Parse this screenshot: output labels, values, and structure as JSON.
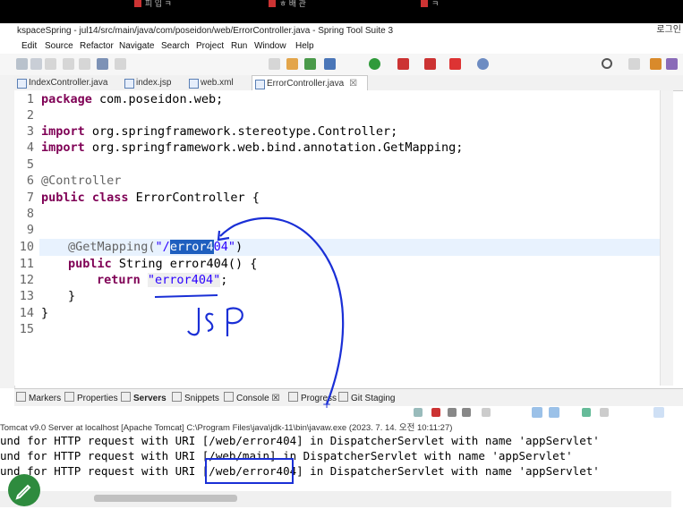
{
  "taskbar": {
    "tabs": [
      "피 입 ㅋ",
      "ㅎ 배 관",
      "ㅋ"
    ],
    "corner": "로그인"
  },
  "window": {
    "title": "kspaceSpring - jul14/src/main/java/com/poseidon/web/ErrorController.java - Spring Tool Suite 3"
  },
  "menu": [
    "Edit",
    "Source",
    "Refactor",
    "Navigate",
    "Search",
    "Project",
    "Run",
    "Window",
    "Help"
  ],
  "editor_tabs": [
    {
      "label": "IndexController.java"
    },
    {
      "label": "index.jsp"
    },
    {
      "label": "web.xml"
    },
    {
      "label": "ErrorController.java",
      "close": "☒"
    }
  ],
  "code": {
    "line_numbers": [
      "1",
      "2",
      "3",
      "4",
      "5",
      "6",
      "7",
      "8",
      "9",
      "10",
      "11",
      "12",
      "13",
      "14",
      "15"
    ],
    "l1_kw": "package",
    "l1_rest": " com.poseidon.web;",
    "l3_kw": "import",
    "l3_rest": " org.springframework.stereotype.Controller;",
    "l4_kw": "import",
    "l4_rest": " org.springframework.web.bind.annotation.GetMapping;",
    "l6": "@Controller",
    "l7_kw": "public class",
    "l7_rest": " ErrorController {",
    "l10_ann": "@GetMapping(",
    "l10_str_a": "\"/",
    "l10_sel": "error4",
    "l10_str_b": "04\"",
    "l10_end": ")",
    "l11_kw": "public",
    "l11_rest": " String error404() {",
    "l12_kw": "return",
    "l12_str": "\"error404\"",
    "l12_end": ";",
    "l13": "}",
    "l14": "}"
  },
  "panel_tabs": [
    {
      "label": "Markers"
    },
    {
      "label": "Properties"
    },
    {
      "label": "Servers"
    },
    {
      "label": "Snippets"
    },
    {
      "label": "Console ☒"
    },
    {
      "label": "Progress"
    },
    {
      "label": "Git Staging"
    }
  ],
  "console": {
    "description": "Tomcat v9.0 Server at localhost [Apache Tomcat] C:\\Program Files\\java\\jdk-11\\bin\\javaw.exe  (2023. 7. 14. 오전 10:11:27)",
    "lines": [
      "und for HTTP request with URI [/web/error404] in DispatcherServlet with name 'appServlet'",
      "und for HTTP request with URI [/web/main] in DispatcherServlet with name 'appServlet'",
      "und for HTTP request with URI [/web/error404] in DispatcherServlet with name 'appServlet'"
    ]
  },
  "annotation": {
    "handwritten": "JSP"
  },
  "colors": {
    "keyword": "#7f0055",
    "string": "#2a00ff",
    "annotation": "#646464",
    "selection": "#1f5fbf",
    "pen": "#1a2fd6"
  }
}
